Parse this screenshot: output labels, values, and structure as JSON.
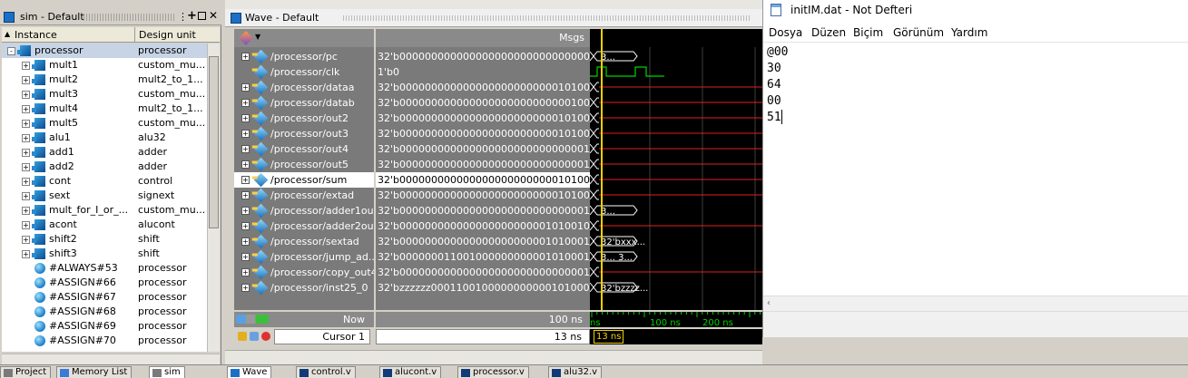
{
  "sim": {
    "title": "sim - Default",
    "col_instance": "Instance",
    "col_design": "Design unit",
    "items": [
      {
        "name": "processor",
        "unit": "processor",
        "kind": "block",
        "expand": "-",
        "selected": true
      },
      {
        "name": "mult1",
        "unit": "custom_mu...",
        "kind": "block",
        "expand": "+"
      },
      {
        "name": "mult2",
        "unit": "mult2_to_1...",
        "kind": "block",
        "expand": "+"
      },
      {
        "name": "mult3",
        "unit": "custom_mu...",
        "kind": "block",
        "expand": "+"
      },
      {
        "name": "mult4",
        "unit": "mult2_to_1...",
        "kind": "block",
        "expand": "+"
      },
      {
        "name": "mult5",
        "unit": "custom_mu...",
        "kind": "block",
        "expand": "+"
      },
      {
        "name": "alu1",
        "unit": "alu32",
        "kind": "block",
        "expand": "+"
      },
      {
        "name": "add1",
        "unit": "adder",
        "kind": "block",
        "expand": "+"
      },
      {
        "name": "add2",
        "unit": "adder",
        "kind": "block",
        "expand": "+"
      },
      {
        "name": "cont",
        "unit": "control",
        "kind": "block",
        "expand": "+"
      },
      {
        "name": "sext",
        "unit": "signext",
        "kind": "block",
        "expand": "+"
      },
      {
        "name": "mult_for_I_or_...",
        "unit": "custom_mu...",
        "kind": "block",
        "expand": "+"
      },
      {
        "name": "acont",
        "unit": "alucont",
        "kind": "block",
        "expand": "+"
      },
      {
        "name": "shift2",
        "unit": "shift",
        "kind": "block",
        "expand": "+"
      },
      {
        "name": "shift3",
        "unit": "shift",
        "kind": "block",
        "expand": "+"
      },
      {
        "name": "#ALWAYS#53",
        "unit": "processor",
        "kind": "ball"
      },
      {
        "name": "#ASSIGN#66",
        "unit": "processor",
        "kind": "ball"
      },
      {
        "name": "#ASSIGN#67",
        "unit": "processor",
        "kind": "ball"
      },
      {
        "name": "#ASSIGN#68",
        "unit": "processor",
        "kind": "ball"
      },
      {
        "name": "#ASSIGN#69",
        "unit": "processor",
        "kind": "ball"
      },
      {
        "name": "#ASSIGN#70",
        "unit": "processor",
        "kind": "ball"
      }
    ]
  },
  "wave": {
    "title": "Wave - Default",
    "msgs_label": "Msgs",
    "signals": [
      {
        "name": "/processor/pc",
        "value": "32'b00000000000000000000000000000000",
        "expand": true,
        "wave": "3..."
      },
      {
        "name": "/processor/clk",
        "value": "1'b0",
        "expand": false,
        "wave": "clk"
      },
      {
        "name": "/processor/dataa",
        "value": "32'b00000000000000000000000001010000",
        "expand": true,
        "wave": ""
      },
      {
        "name": "/processor/datab",
        "value": "32'b00000000000000000000000000010000",
        "expand": true,
        "wave": ""
      },
      {
        "name": "/processor/out2",
        "value": "32'b00000000000000000000000001010001",
        "expand": true,
        "wave": ""
      },
      {
        "name": "/processor/out3",
        "value": "32'b00000000000000000000000001010000",
        "expand": true,
        "wave": ""
      },
      {
        "name": "/processor/out4",
        "value": "32'b00000000000000000000000000000100",
        "expand": true,
        "wave": ""
      },
      {
        "name": "/processor/out5",
        "value": "32'b00000000000000000000000000000100",
        "expand": true,
        "wave": ""
      },
      {
        "name": "/processor/sum",
        "value": "32'b00000000000000000000000001010000",
        "expand": true,
        "wave": "",
        "selected": true
      },
      {
        "name": "/processor/extad",
        "value": "32'b00000000000000000000000001010001",
        "expand": true,
        "wave": ""
      },
      {
        "name": "/processor/adder1out",
        "value": "32'b00000000000000000000000000000100",
        "expand": true,
        "wave": "3..."
      },
      {
        "name": "/processor/adder2out",
        "value": "32'b00000000000000000000000101001000",
        "expand": true,
        "wave": ""
      },
      {
        "name": "/processor/sextad",
        "value": "32'b00000000000000000000000101000100",
        "expand": true,
        "wave": "32'bxxx..."
      },
      {
        "name": "/processor/jump_ad...",
        "value": "32'b00000001100100000000000101000100",
        "expand": true,
        "wave": "3...   3..."
      },
      {
        "name": "/processor/copy_out4",
        "value": "32'b00000000000000000000000000000100",
        "expand": true,
        "wave": ""
      },
      {
        "name": "/processor/inst25_0",
        "value": "32'bzzzzzz00011001000000000001010001",
        "expand": true,
        "wave": "32'bzzzz..."
      }
    ],
    "now_label": "Now",
    "now_value": "100 ns",
    "cursor_label": "Cursor 1",
    "cursor_value": "13 ns",
    "cursor_marker": "13 ns",
    "ruler_labels": [
      "ns",
      "100 ns",
      "200 ns"
    ],
    "colors": {
      "wave_green": "#00d000",
      "wave_red": "#e02020",
      "cursor": "#f0d000"
    }
  },
  "notepad": {
    "title": "initIM.dat - Not Defteri",
    "menu": [
      "Dosya",
      "Düzen",
      "Biçim",
      "Görünüm",
      "Yardım"
    ],
    "lines": [
      "@00",
      "30",
      "64",
      "00",
      "51"
    ]
  },
  "tabs": {
    "left": [
      "Project",
      "Memory List",
      "sim"
    ],
    "right": [
      "Wave",
      "control.v",
      "alucont.v",
      "processor.v",
      "alu32.v"
    ]
  }
}
